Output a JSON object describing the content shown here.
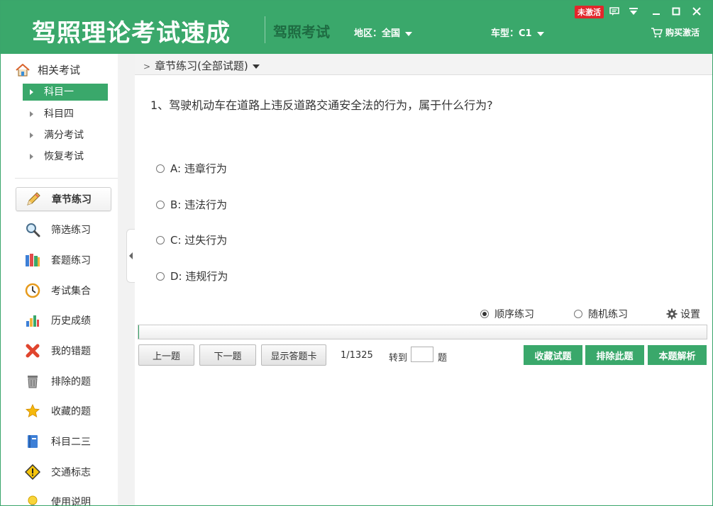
{
  "header": {
    "app_title": "驾照理论考试速成",
    "sub_title": "驾照考试",
    "region_label": "地区：全国",
    "vehicle_label": "车型：C1",
    "activation_badge": "未激活",
    "buy_label": "购买激活",
    "brand_color": "#3aa86b"
  },
  "sidebar": {
    "section_title": "相关考试",
    "exams": [
      {
        "label": "科目一",
        "active": true
      },
      {
        "label": "科目四",
        "active": false
      },
      {
        "label": "满分考试",
        "active": false
      },
      {
        "label": "恢复考试",
        "active": false
      }
    ],
    "nav": [
      {
        "label": "章节练习",
        "icon": "pencil-icon",
        "active": true
      },
      {
        "label": "筛选练习",
        "icon": "magnifier-icon",
        "active": false
      },
      {
        "label": "套题练习",
        "icon": "books-icon",
        "active": false
      },
      {
        "label": "考试集合",
        "icon": "clock-icon",
        "active": false
      },
      {
        "label": "历史成绩",
        "icon": "bar-chart-icon",
        "active": false
      },
      {
        "label": "我的错题",
        "icon": "red-x-icon",
        "active": false
      },
      {
        "label": "排除的题",
        "icon": "trash-icon",
        "active": false
      },
      {
        "label": "收藏的题",
        "icon": "star-icon",
        "active": false
      },
      {
        "label": "科目二三",
        "icon": "book-icon",
        "active": false
      },
      {
        "label": "交通标志",
        "icon": "warning-sign-icon",
        "active": false
      },
      {
        "label": "使用说明",
        "icon": "lightbulb-icon",
        "active": false
      }
    ]
  },
  "main": {
    "breadcrumb": "章节练习(全部试题)",
    "question": "1、驾驶机动车在道路上违反道路交通安全法的行为，属于什么行为?",
    "options": [
      {
        "label": "A: 违章行为"
      },
      {
        "label": "B: 违法行为"
      },
      {
        "label": "C: 过失行为"
      },
      {
        "label": "D: 违规行为"
      }
    ],
    "mode_sequential": "顺序练习",
    "mode_random": "随机练习",
    "selected_mode": "顺序练习",
    "settings_label": "设置",
    "progress": 0.00075,
    "prev_label": "上一题",
    "next_label": "下一题",
    "answer_card_label": "显示答题卡",
    "counter": "1/1325",
    "goto_label": "转到",
    "goto_value": "",
    "goto_suffix": "题",
    "favorite_label": "收藏试题",
    "exclude_label": "排除此题",
    "analysis_label": "本题解析"
  }
}
